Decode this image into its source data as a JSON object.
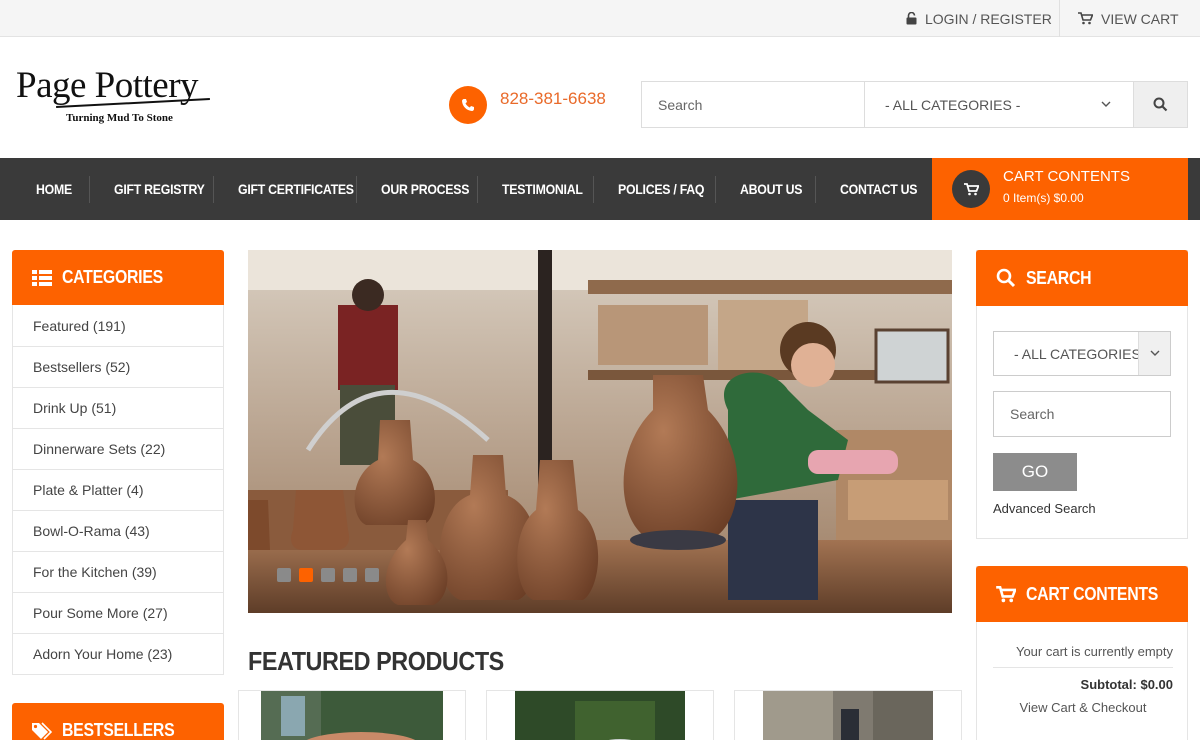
{
  "topbar": {
    "login": "LOGIN / REGISTER",
    "cart": "VIEW CART"
  },
  "header": {
    "logo_title": "Page Pottery",
    "logo_tagline": "Turning Mud To Stone",
    "phone": "828-381-6638",
    "search_placeholder": "Search",
    "category_selected": "- ALL CATEGORIES -"
  },
  "nav": {
    "items": [
      "HOME",
      "GIFT REGISTRY",
      "GIFT CERTIFICATES",
      "OUR PROCESS",
      "TESTIMONIAL",
      "POLICES / FAQ",
      "ABOUT US",
      "CONTACT US"
    ],
    "cart_title": "CART CONTENTS",
    "cart_summary": "0 Item(s) $0.00"
  },
  "categories": {
    "title": "CATEGORIES",
    "items": [
      "Featured (191)",
      "Bestsellers (52)",
      "Drink Up (51)",
      "Dinnerware Sets (22)",
      "Plate & Platter (4)",
      "Bowl-O-Rama (43)",
      "For the Kitchen (39)",
      "Pour Some More (27)",
      "Adorn Your Home (23)"
    ]
  },
  "bestsellers": {
    "title": "BESTSELLERS"
  },
  "slider": {
    "active_slide": 2,
    "slide_count": 5
  },
  "featured": {
    "title": "FEATURED PRODUCTS"
  },
  "side_search": {
    "title": "SEARCH",
    "category_selected": "- ALL CATEGORIES -",
    "placeholder": "Search",
    "go_label": "GO",
    "advanced": "Advanced Search"
  },
  "side_cart": {
    "title": "CART CONTENTS",
    "empty_text": "Your cart is currently empty",
    "subtotal": "Subtotal: $0.00",
    "view_checkout": "View Cart & Checkout"
  },
  "colors": {
    "accent": "#fd6200",
    "nav_bg": "#3a3a3a"
  }
}
